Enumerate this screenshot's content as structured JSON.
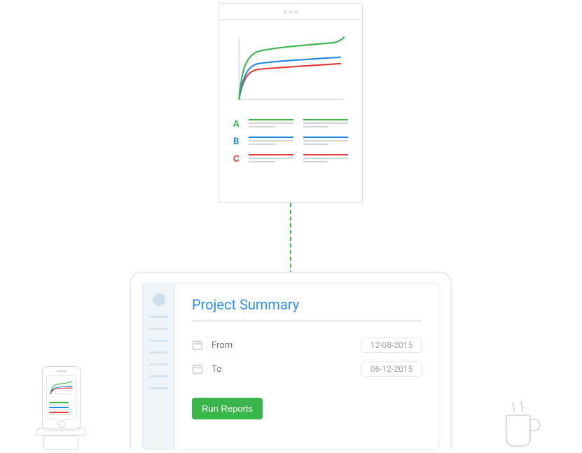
{
  "report": {
    "legend": [
      {
        "letter": "A",
        "color": "#3ab54a"
      },
      {
        "letter": "B",
        "color": "#1e88e5"
      },
      {
        "letter": "C",
        "color": "#e53935"
      }
    ]
  },
  "chart_data": {
    "type": "line",
    "x": [
      0,
      1,
      2,
      3,
      4,
      5,
      6,
      7,
      8,
      9,
      10
    ],
    "series": [
      {
        "name": "A",
        "color": "#3ab54a",
        "values": [
          0,
          40,
          58,
          68,
          74,
          78,
          80,
          82,
          84,
          87,
          92
        ]
      },
      {
        "name": "B",
        "color": "#1e88e5",
        "values": [
          0,
          30,
          45,
          53,
          57,
          59,
          60,
          61,
          62,
          63,
          65
        ]
      },
      {
        "name": "C",
        "color": "#e53935",
        "values": [
          0,
          25,
          38,
          45,
          48,
          50,
          51,
          52,
          53,
          54,
          56
        ]
      }
    ],
    "xlim": [
      0,
      10
    ],
    "ylim": [
      0,
      100
    ],
    "title": "",
    "xlabel": "",
    "ylabel": ""
  },
  "app": {
    "title": "Project Summary",
    "from_label": "From",
    "to_label": "To",
    "from_value": "12-08-2015",
    "to_value": "06-12-2015",
    "run_label": "Run Reports"
  },
  "colors": {
    "green": "#3ab54a",
    "blue": "#1e88e5",
    "red": "#e53935",
    "muted": "#cfd4d9",
    "title_blue": "#2f8fe8"
  }
}
